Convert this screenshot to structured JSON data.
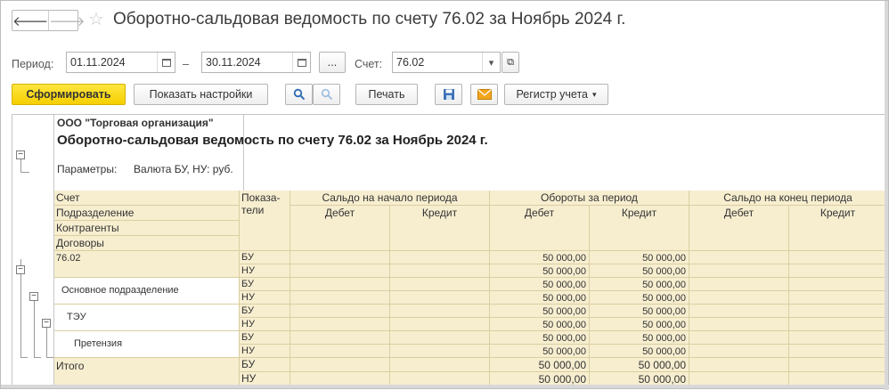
{
  "window": {
    "title": "Оборотно-сальдовая ведомость по счету 76.02 за Ноябрь 2024 г.",
    "back_glyph": "🡐",
    "forward_glyph": "🡒",
    "star_glyph": "☆"
  },
  "filters": {
    "period_label": "Период:",
    "date_from": "01.11.2024",
    "dash": "–",
    "date_to": "30.11.2024",
    "more_label": "...",
    "account_label": "Счет:",
    "account_value": "76.02",
    "dropdown_glyph": "▾",
    "open_glyph": "⧉"
  },
  "toolbar": {
    "generate": "Сформировать",
    "show_settings": "Показать настройки",
    "print": "Печать",
    "register": "Регистр учета",
    "register_arrow": "▾"
  },
  "report": {
    "org": "ООО \"Торговая организация\"",
    "title": "Оборотно-сальдовая ведомость по счету 76.02 за Ноябрь 2024 г.",
    "params_label": "Параметры:",
    "params_value": "Валюта БУ, НУ: руб.",
    "header": {
      "dims": [
        "Счет",
        "Подразделение",
        "Контрагенты",
        "Договоры"
      ],
      "indicators": "Показа-\nтели",
      "opening": "Сальдо на начало периода",
      "turnover": "Обороты за период",
      "closing": "Сальдо на конец периода",
      "debit": "Дебет",
      "credit": "Кредит"
    },
    "groups": [
      {
        "name": "76.02",
        "rows": [
          {
            "ind": "БУ",
            "od": "",
            "oc": "",
            "td": "50 000,00",
            "tc": "50 000,00",
            "cd": "",
            "cc": ""
          },
          {
            "ind": "НУ",
            "od": "",
            "oc": "",
            "td": "50 000,00",
            "tc": "50 000,00",
            "cd": "",
            "cc": ""
          }
        ]
      },
      {
        "name": "Основное подразделение",
        "rows": [
          {
            "ind": "БУ",
            "od": "",
            "oc": "",
            "td": "50 000,00",
            "tc": "50 000,00",
            "cd": "",
            "cc": ""
          },
          {
            "ind": "НУ",
            "od": "",
            "oc": "",
            "td": "50 000,00",
            "tc": "50 000,00",
            "cd": "",
            "cc": ""
          }
        ]
      },
      {
        "name": "ТЭУ",
        "rows": [
          {
            "ind": "БУ",
            "od": "",
            "oc": "",
            "td": "50 000,00",
            "tc": "50 000,00",
            "cd": "",
            "cc": ""
          },
          {
            "ind": "НУ",
            "od": "",
            "oc": "",
            "td": "50 000,00",
            "tc": "50 000,00",
            "cd": "",
            "cc": ""
          }
        ]
      },
      {
        "name": "Претензия",
        "rows": [
          {
            "ind": "БУ",
            "od": "",
            "oc": "",
            "td": "50 000,00",
            "tc": "50 000,00",
            "cd": "",
            "cc": ""
          },
          {
            "ind": "НУ",
            "od": "",
            "oc": "",
            "td": "50 000,00",
            "tc": "50 000,00",
            "cd": "",
            "cc": ""
          }
        ]
      }
    ],
    "total": {
      "label": "Итого",
      "rows": [
        {
          "ind": "БУ",
          "td": "50 000,00",
          "tc": "50 000,00"
        },
        {
          "ind": "НУ",
          "td": "50 000,00",
          "tc": "50 000,00"
        }
      ]
    }
  },
  "tree_glyph": "−"
}
